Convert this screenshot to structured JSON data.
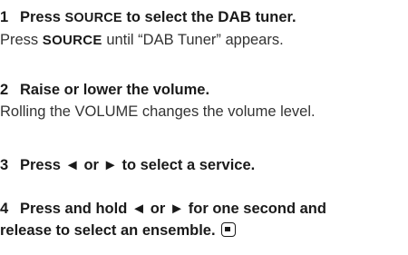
{
  "steps": [
    {
      "number": "1",
      "heading_pre": "Press ",
      "heading_keyword": "SOURCE",
      "heading_mid": " to select the ",
      "heading_brand": "DAB",
      "heading_post": " tuner.",
      "body_pre": "Press ",
      "body_keyword": "SOURCE",
      "body_post": " until “DAB Tuner” appears."
    },
    {
      "number": "2",
      "heading": "Raise or lower the volume.",
      "body": "Rolling the VOLUME changes the volume level."
    },
    {
      "number": "3",
      "heading": "Press ◄ or ► to select a service."
    },
    {
      "number": "4",
      "heading_line1": "Press and hold ◄ or ► for one second and",
      "heading_line2": "release to select an ensemble.",
      "end_icon": "stop-square-icon"
    }
  ]
}
